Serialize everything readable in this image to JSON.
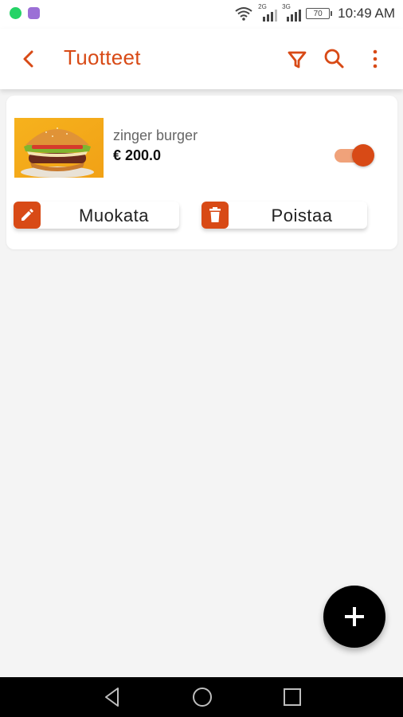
{
  "status_bar": {
    "time": "10:49 AM",
    "battery": "70",
    "signal_1": "2G",
    "signal_2": "3G",
    "whatsapp_color": "#25D366",
    "viber_color": "#9b6fd6"
  },
  "app_bar": {
    "title": "Tuotteet",
    "accent_color": "#d84a16",
    "icons": [
      "back-arrow-icon",
      "filter-icon",
      "search-icon",
      "more-vert-icon"
    ]
  },
  "product": {
    "name": "zinger burger",
    "price": "€ 200.0",
    "image_icon": "burger-image",
    "enabled": true
  },
  "actions": {
    "edit_label": "Muokata",
    "delete_label": "Poistaa",
    "edit_icon": "pencil-icon",
    "delete_icon": "trash-icon"
  },
  "fab": {
    "icon": "plus-icon"
  },
  "nav_bar": {
    "icons": [
      "nav-back-icon",
      "nav-home-icon",
      "nav-recent-icon"
    ]
  }
}
